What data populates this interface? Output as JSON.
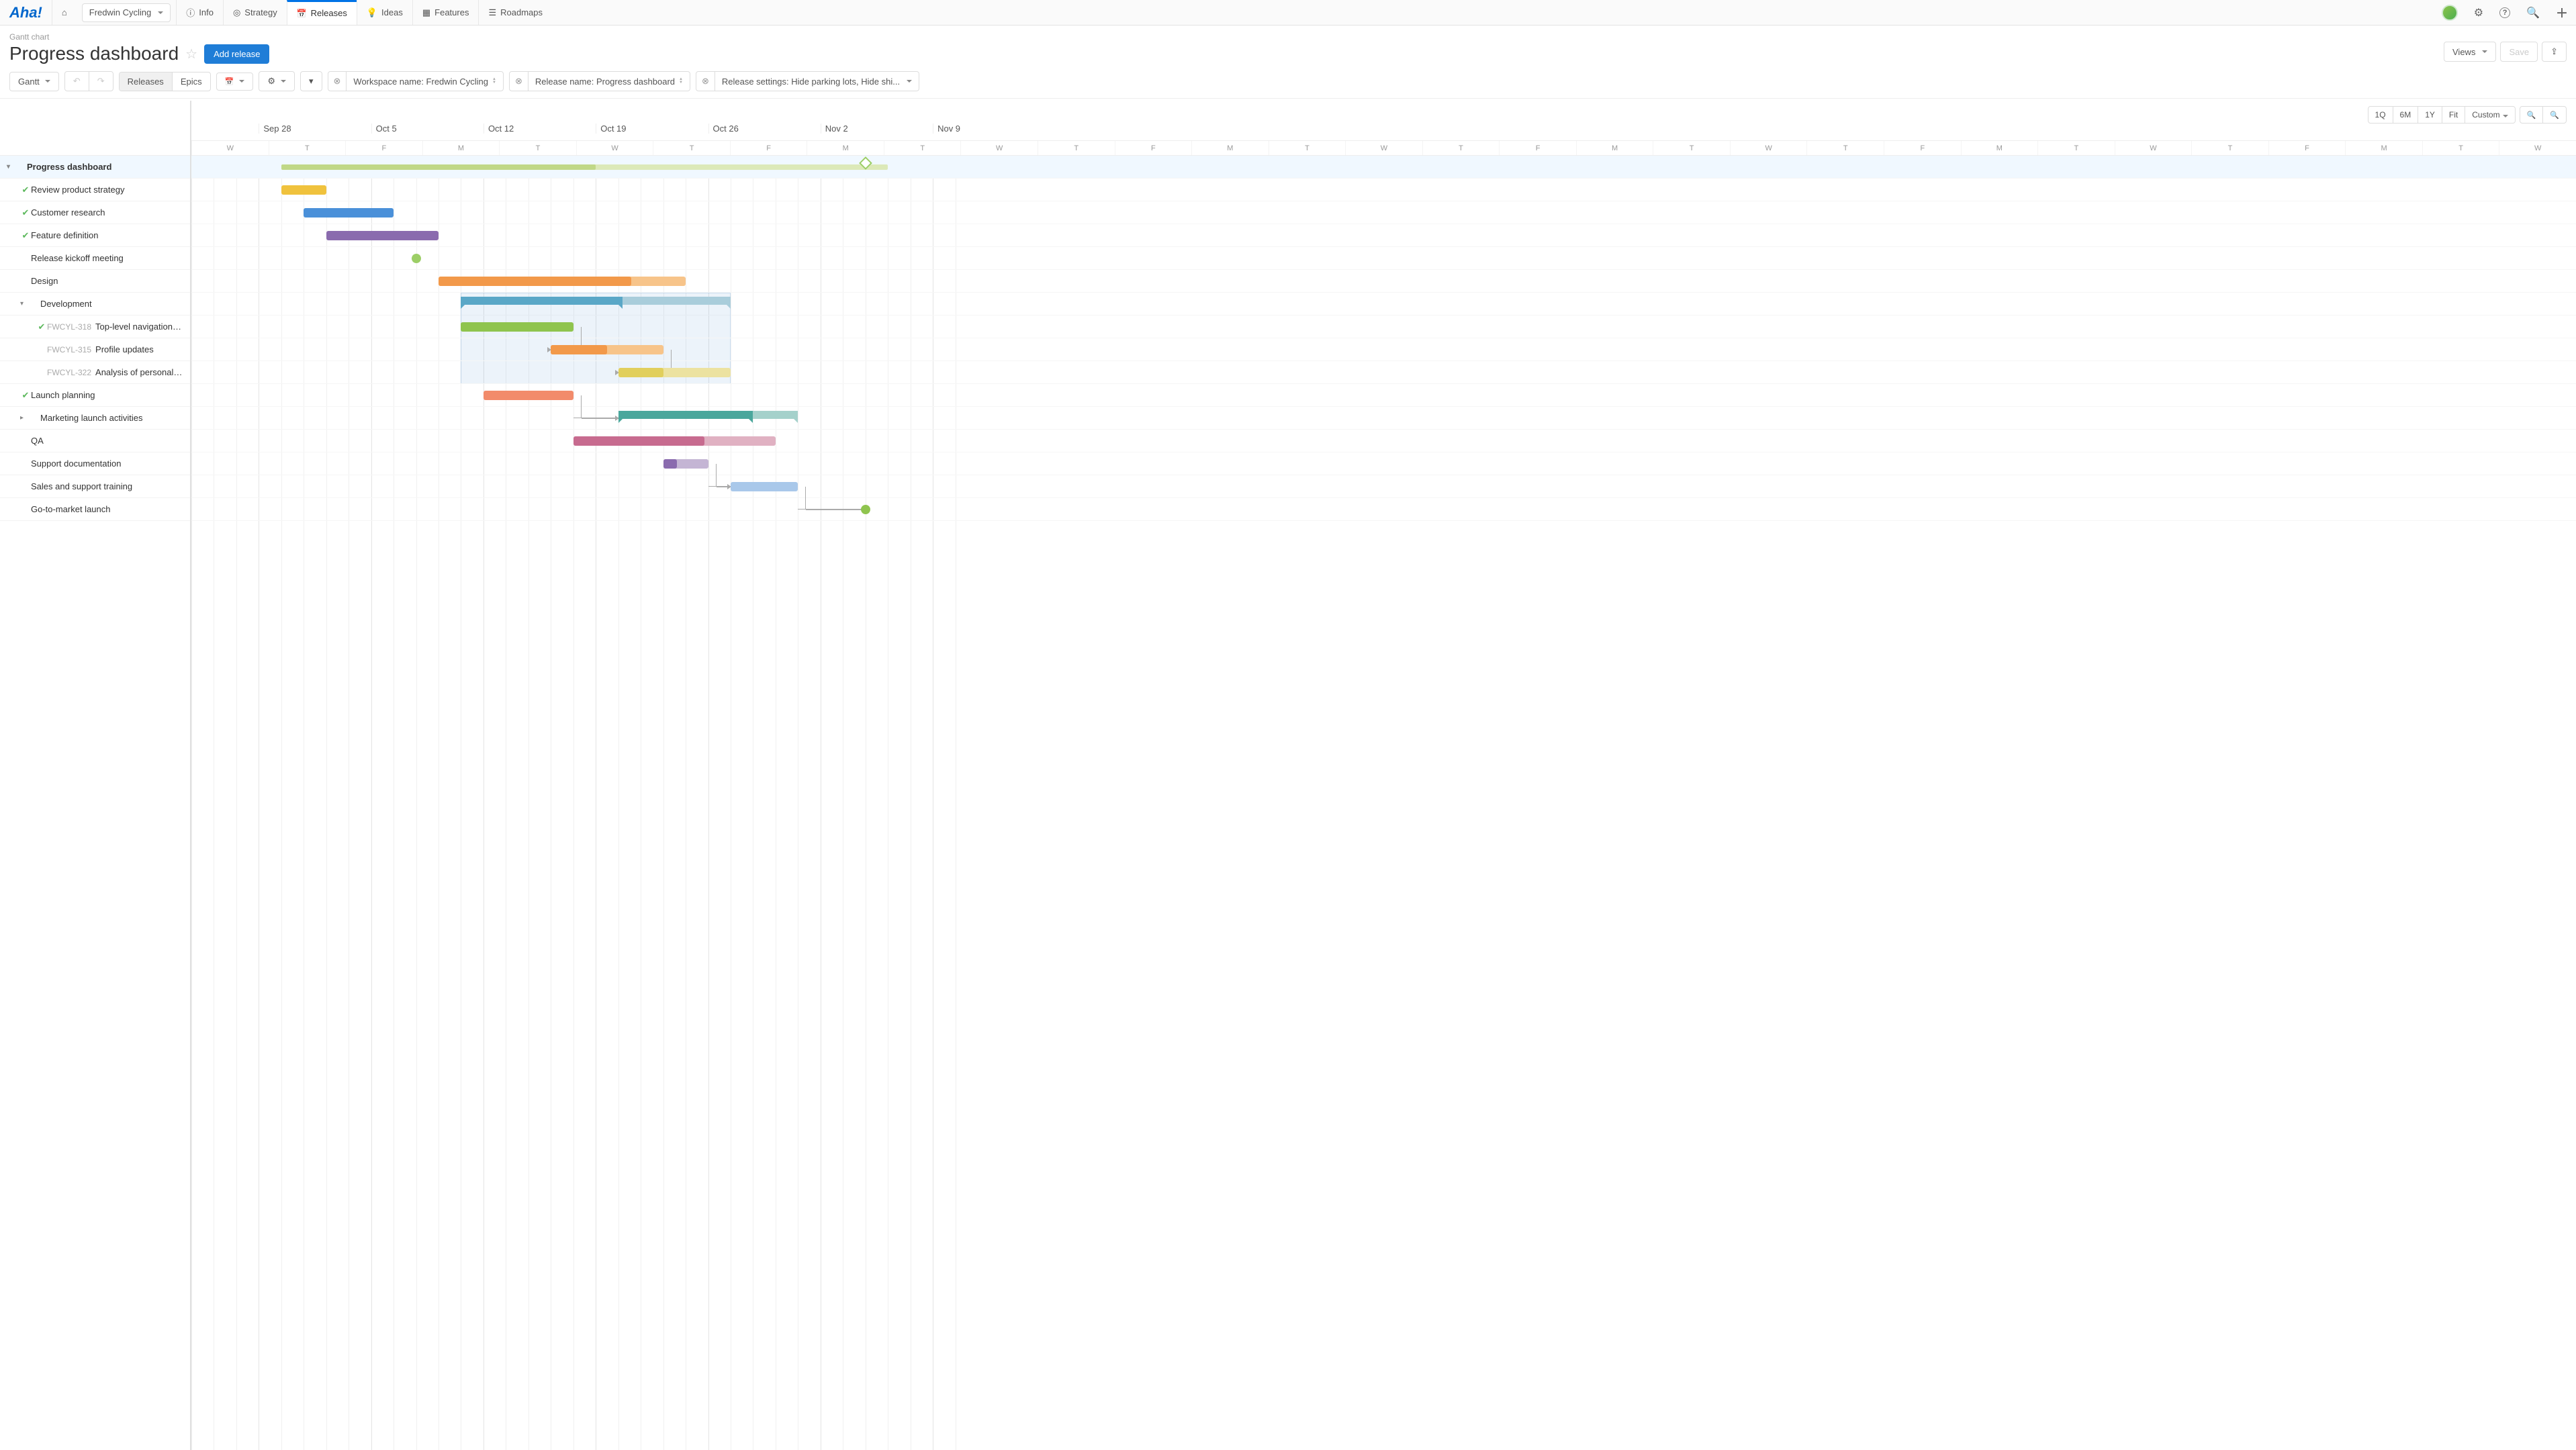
{
  "logo": "Aha!",
  "workspace_dropdown": "Fredwin Cycling",
  "nav": {
    "info": "Info",
    "strategy": "Strategy",
    "releases": "Releases",
    "ideas": "Ideas",
    "features": "Features",
    "roadmaps": "Roadmaps"
  },
  "breadcrumb": "Gantt chart",
  "page_title": "Progress dashboard",
  "add_release": "Add release",
  "views_btn": "Views",
  "save_btn": "Save",
  "toolbar": {
    "gantt": "Gantt",
    "releases": "Releases",
    "epics": "Epics"
  },
  "filters": {
    "workspace": "Workspace name: Fredwin Cycling",
    "release": "Release name: Progress dashboard",
    "settings": "Release settings: Hide parking lots, Hide shi..."
  },
  "zoom": {
    "q1": "1Q",
    "m6": "6M",
    "y1": "1Y",
    "fit": "Fit",
    "custom": "Custom"
  },
  "timeline": {
    "weeks": [
      "Sep 28",
      "Oct 5",
      "Oct 12",
      "Oct 19",
      "Oct 26",
      "Nov 2",
      "Nov 9"
    ],
    "day_letters": [
      "W",
      "T",
      "F",
      "M",
      "T",
      "W",
      "T",
      "F",
      "M",
      "T",
      "W",
      "T",
      "F",
      "M",
      "T",
      "W",
      "T",
      "F",
      "M",
      "T",
      "W",
      "T",
      "F",
      "M",
      "T",
      "W",
      "T",
      "F",
      "M",
      "T",
      "W"
    ]
  },
  "rows": [
    {
      "type": "head",
      "label": "Progress dashboard",
      "chev": "▾"
    },
    {
      "type": "task",
      "label": "Review product strategy",
      "status": "ok"
    },
    {
      "type": "task",
      "label": "Customer research",
      "status": "ok"
    },
    {
      "type": "task",
      "label": "Feature definition",
      "status": "ok"
    },
    {
      "type": "task",
      "label": "Release kickoff meeting"
    },
    {
      "type": "task",
      "label": "Design"
    },
    {
      "type": "group",
      "label": "Development",
      "chev": "▾"
    },
    {
      "type": "sub",
      "ref": "FWCYL-318",
      "label": "Top-level navigation re...",
      "status": "ok"
    },
    {
      "type": "sub",
      "ref": "FWCYL-315",
      "label": "Profile updates"
    },
    {
      "type": "sub",
      "ref": "FWCYL-322",
      "label": "Analysis of personal race g..."
    },
    {
      "type": "task",
      "label": "Launch planning",
      "status": "ok"
    },
    {
      "type": "group",
      "label": "Marketing launch activities",
      "chev": "▸"
    },
    {
      "type": "task",
      "label": "QA"
    },
    {
      "type": "task",
      "label": "Support documentation"
    },
    {
      "type": "task",
      "label": "Sales and support training"
    },
    {
      "type": "task",
      "label": "Go-to-market launch"
    }
  ],
  "chart_data": {
    "type": "gantt",
    "date_range": [
      "2020-09-23",
      "2020-11-11"
    ],
    "tasks": [
      {
        "name": "Progress dashboard",
        "start": "2020-09-29",
        "end": "2020-10-19",
        "type": "summary",
        "color": "#c5dd8e",
        "milestone": "2020-11-04"
      },
      {
        "name": "Review product strategy",
        "start": "2020-09-29",
        "end": "2020-10-01",
        "color": "#f0c23d"
      },
      {
        "name": "Customer research",
        "start": "2020-09-30",
        "end": "2020-10-06",
        "color": "#4a90d9"
      },
      {
        "name": "Feature definition",
        "start": "2020-10-01",
        "end": "2020-10-08",
        "color": "#8a6bae"
      },
      {
        "name": "Release kickoff meeting",
        "start": "2020-10-07",
        "type": "milestone",
        "color": "#9cce66"
      },
      {
        "name": "Design",
        "start": "2020-10-08",
        "end": "2020-10-23",
        "progress": 0.78,
        "color": "#f2994a"
      },
      {
        "name": "Development",
        "start": "2020-10-09",
        "end": "2020-10-27",
        "type": "summary",
        "color": "#5aa7c7",
        "progress": 0.6
      },
      {
        "name": "Top-level navigation re...",
        "ref": "FWCYL-318",
        "start": "2020-10-09",
        "end": "2020-10-17",
        "color": "#8fc44e"
      },
      {
        "name": "Profile updates",
        "ref": "FWCYL-315",
        "start": "2020-10-15",
        "end": "2020-10-22",
        "progress": 0.5,
        "color": "#f2994a"
      },
      {
        "name": "Analysis of personal race g...",
        "ref": "FWCYL-322",
        "start": "2020-10-20",
        "end": "2020-10-27",
        "progress": 0.4,
        "color": "#e1cf5c"
      },
      {
        "name": "Launch planning",
        "start": "2020-10-12",
        "end": "2020-10-16",
        "color": "#f28b6b"
      },
      {
        "name": "Marketing launch activities",
        "start": "2020-10-20",
        "end": "2020-10-30",
        "type": "summary",
        "color": "#4aa79c",
        "progress": 0.75
      },
      {
        "name": "QA",
        "start": "2020-10-16",
        "end": "2020-10-29",
        "progress": 0.65,
        "color": "#c76b8f"
      },
      {
        "name": "Support documentation",
        "start": "2020-10-22",
        "end": "2020-10-26",
        "progress": 0.3,
        "color": "#8a6bae"
      },
      {
        "name": "Sales and support training",
        "start": "2020-10-27",
        "end": "2020-11-01",
        "color": "#8fb9e6"
      },
      {
        "name": "Go-to-market launch",
        "start": "2020-11-04",
        "type": "milestone",
        "color": "#8fc44e"
      }
    ],
    "dependencies": [
      [
        "Top-level navigation re...",
        "Profile updates"
      ],
      [
        "Profile updates",
        "Analysis of personal race g..."
      ],
      [
        "Launch planning",
        "Marketing launch activities"
      ],
      [
        "Support documentation",
        "Sales and support training"
      ],
      [
        "Sales and support training",
        "Go-to-market launch"
      ]
    ]
  }
}
